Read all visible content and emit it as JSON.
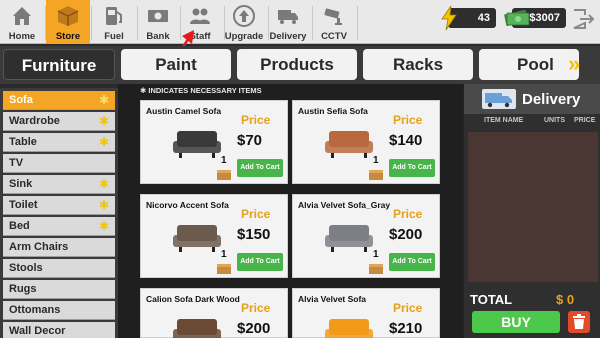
{
  "nav": {
    "items": [
      {
        "label": "Home",
        "icon": "home-icon"
      },
      {
        "label": "Store",
        "icon": "store-box-icon",
        "active": true
      },
      {
        "label": "Fuel",
        "icon": "fuel-pump-icon"
      },
      {
        "label": "Bank",
        "icon": "cash-icon"
      },
      {
        "label": "Staff",
        "icon": "staff-people-icon"
      },
      {
        "label": "Upgrade",
        "icon": "upgrade-arrow-icon"
      },
      {
        "label": "Delivery",
        "icon": "delivery-truck-icon"
      },
      {
        "label": "CCTV",
        "icon": "cctv-camera-icon"
      }
    ],
    "energy": "43",
    "money": "$3007"
  },
  "categories": {
    "tabs": [
      "Furniture",
      "Paint",
      "Products",
      "Racks",
      "Pool"
    ],
    "active_index": 0,
    "right_arrow": "»"
  },
  "sidebar": {
    "items": [
      {
        "label": "Sofa",
        "required": true,
        "active": true
      },
      {
        "label": "Wardrobe",
        "required": true
      },
      {
        "label": "Table",
        "required": true
      },
      {
        "label": "TV",
        "required": false
      },
      {
        "label": "Sink",
        "required": true
      },
      {
        "label": "Toilet",
        "required": true
      },
      {
        "label": "Bed",
        "required": true
      },
      {
        "label": "Arm Chairs",
        "required": false
      },
      {
        "label": "Stools",
        "required": false
      },
      {
        "label": "Rugs",
        "required": false
      },
      {
        "label": "Ottomans",
        "required": false
      },
      {
        "label": "Wall Decor",
        "required": false
      }
    ],
    "required_mark": "✱"
  },
  "main": {
    "note": "✱ INDICATES NECESSARY ITEMS",
    "price_label": "Price",
    "add_label": "Add To Cart",
    "products": [
      {
        "name": "Austin Camel Sofa",
        "price": "$70",
        "qty": "1",
        "color": "#3a3a3a"
      },
      {
        "name": "Austin Sefia Sofa",
        "price": "$140",
        "qty": "1",
        "color": "#b9683d"
      },
      {
        "name": "Nicorvo Accent Sofa",
        "price": "$150",
        "qty": "1",
        "color": "#6b5b4d"
      },
      {
        "name": "Alvia Velvet Sofa_Gray",
        "price": "$200",
        "qty": "1",
        "color": "#7c7f85"
      },
      {
        "name": "Calion Sofa Dark Wood",
        "price": "$200",
        "qty": "",
        "color": "#6a4a35"
      },
      {
        "name": "Alvia Velvet Sofa",
        "price": "$210",
        "qty": "",
        "color": "#f39a1a"
      }
    ]
  },
  "delivery": {
    "title": "Delivery",
    "columns": [
      "ITEM NAME",
      "UNITS",
      "PRICE"
    ],
    "total_label": "TOTAL",
    "total_value": "$ 0",
    "buy_label": "BUY"
  },
  "colors": {
    "accent_orange": "#f5a526",
    "buy_green": "#4cc84a",
    "delete_red": "#e24a2a"
  }
}
